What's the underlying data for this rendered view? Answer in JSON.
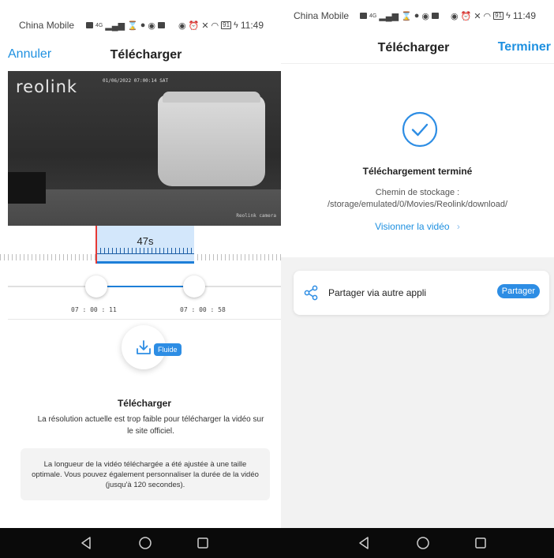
{
  "left_phone": {
    "status_bar": {
      "carrier": "China Mobile",
      "network": "4G",
      "battery": "91",
      "time": "11:49"
    },
    "header": {
      "cancel_label": "Annuler",
      "title": "Télécharger"
    },
    "video": {
      "brand": "reolink",
      "timestamp": "01/06/2022 07:00:14 SAT",
      "camera_name": "Reolink camera"
    },
    "timeline": {
      "duration": "47s",
      "start_time": "07 : 00 : 11",
      "end_time": "07 : 00 : 58"
    },
    "download": {
      "badge": "Fluide",
      "title": "Télécharger",
      "note": "La résolution actuelle est trop faible pour télécharger la vidéo sur le site officiel.",
      "info": "La longueur de la vidéo téléchargée a été ajustée à une taille optimale. Vous pouvez également personnaliser la durée de la vidéo (jusqu'à 120 secondes)."
    }
  },
  "right_phone": {
    "status_bar": {
      "carrier": "China Mobile",
      "network": "4G",
      "battery": "91",
      "time": "11:49"
    },
    "header": {
      "title": "Télécharger",
      "finish_label": "Terminer"
    },
    "result": {
      "title": "Téléchargement terminé",
      "path_label": "Chemin de stockage :",
      "path": "/storage/emulated/0/Movies/Reolink/download/",
      "view_link": "Visionner la vidéo"
    },
    "share": {
      "label": "Partager via autre appli",
      "button": "Partager"
    }
  },
  "colors": {
    "accent": "#1e90e0",
    "selection": "#d3e7fb",
    "marker": "#e53935",
    "navbar": "#0a0a0a"
  },
  "nav_icons": [
    "back-triangle-icon",
    "home-circle-icon",
    "recents-square-icon"
  ]
}
